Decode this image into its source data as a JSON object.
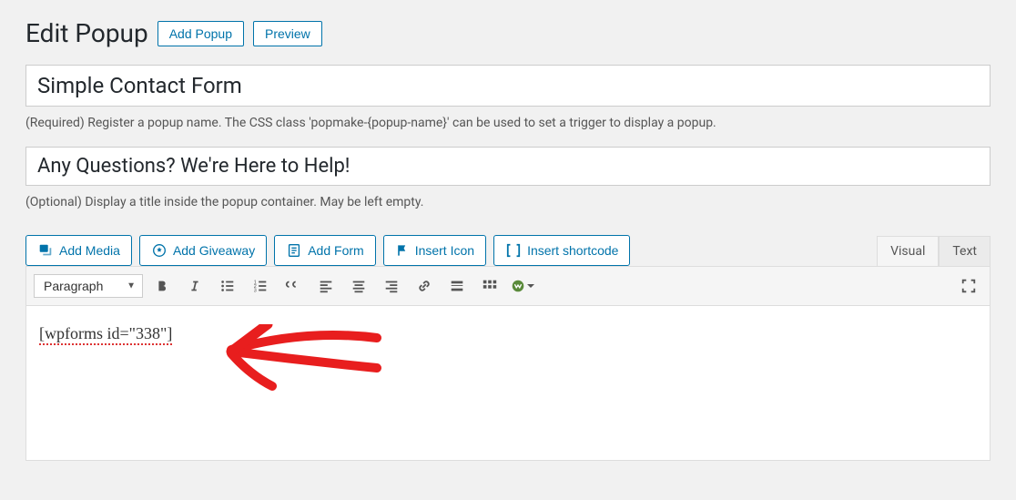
{
  "header": {
    "title": "Edit Popup",
    "add_button": "Add Popup",
    "preview_button": "Preview"
  },
  "popup_name": {
    "value": "Simple Contact Form",
    "helper": "(Required) Register a popup name. The CSS class 'popmake-{popup-name}' can be used to set a trigger to display a popup."
  },
  "popup_title": {
    "value": "Any Questions? We're Here to Help!",
    "helper": "(Optional) Display a title inside the popup container. May be left empty."
  },
  "media_buttons": {
    "add_media": "Add Media",
    "add_giveaway": "Add Giveaway",
    "add_form": "Add Form",
    "insert_icon": "Insert Icon",
    "insert_shortcode": "Insert shortcode"
  },
  "editor_tabs": {
    "visual": "Visual",
    "text": "Text"
  },
  "toolbar": {
    "format": "Paragraph"
  },
  "content": {
    "shortcode": "[wpforms id=\"338\"]"
  },
  "annotation": {
    "arrow_color": "#e81e1e"
  }
}
